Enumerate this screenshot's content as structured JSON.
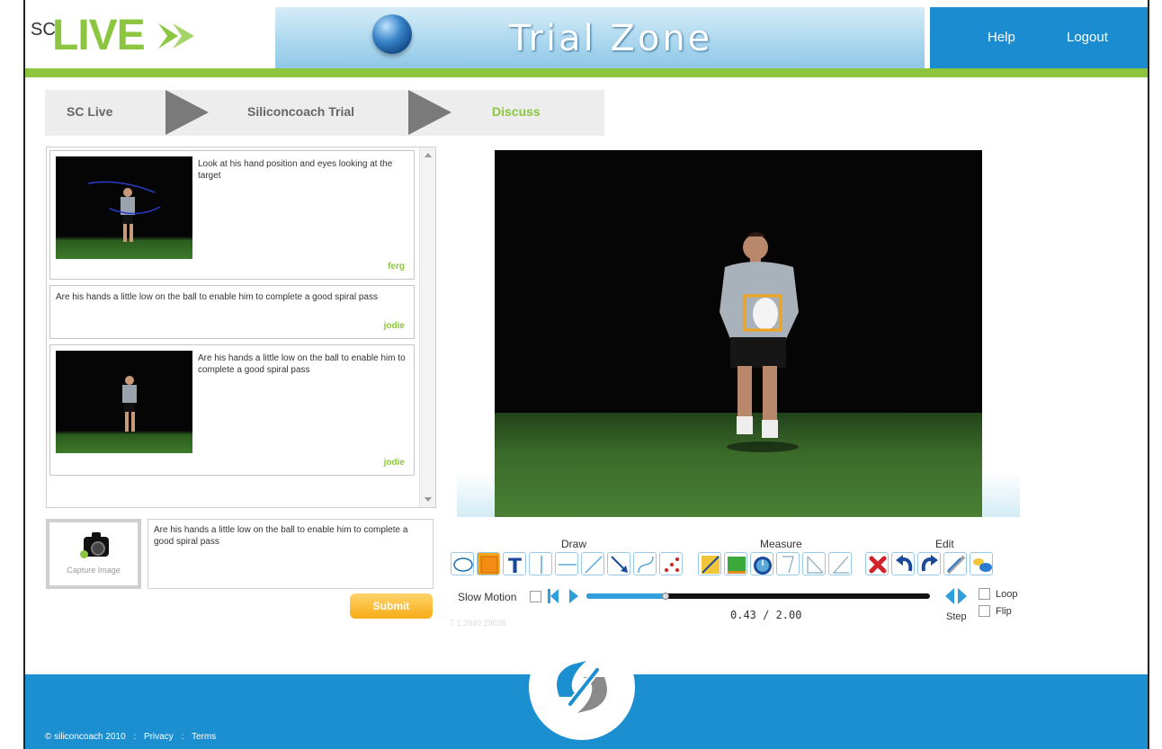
{
  "header": {
    "logo_sc": "SC",
    "logo_live": "LIVE",
    "banner_title": "Trial Zone",
    "nav": [
      "Help",
      "Logout"
    ]
  },
  "breadcrumb": [
    "SC Live",
    "Siliconcoach Trial",
    "Discuss"
  ],
  "comments": [
    {
      "text": "Look at his hand position and eyes looking at the target",
      "author": "ferg",
      "has_thumbnail": true
    },
    {
      "text": "Are his hands a little low on the ball to enable him to complete a good spiral pass",
      "author": "jodie",
      "has_thumbnail": false
    },
    {
      "text": "Are his hands a little low on the ball to enable him to complete a good spiral pass",
      "author": "jodie",
      "has_thumbnail": true
    }
  ],
  "compose": {
    "capture_label": "Capture Image",
    "message": "Are his hands a little low on the ball to enable him to complete a good spiral pass",
    "submit": "Submit"
  },
  "toolbar": {
    "draw_label": "Draw",
    "measure_label": "Measure",
    "edit_label": "Edit",
    "draw_tools": [
      "ellipse-icon",
      "rectangle-icon",
      "text-icon",
      "vertical-line-icon",
      "horizontal-line-icon",
      "line-icon",
      "arrow-icon",
      "curve-icon",
      "dots-icon"
    ],
    "measure_tools": [
      "ruler-icon",
      "area-icon",
      "stopwatch-icon",
      "angle-icon",
      "right-angle-icon",
      "angle-open-icon"
    ],
    "edit_tools": [
      "delete-icon",
      "undo-icon",
      "redo-icon",
      "pen-icon",
      "color-icon"
    ]
  },
  "playback": {
    "slow_motion_label": "Slow Motion",
    "time": "0.43 / 2.00",
    "progress": 0.215,
    "step_label": "Step",
    "loop_label": "Loop",
    "flip_label": "Flip"
  },
  "faded_text": "7.1.2940.29038",
  "footer": {
    "copyright": "© siliconcoach 2010",
    "sep": ":",
    "privacy": "Privacy",
    "terms": "Terms"
  },
  "colors": {
    "accent_green": "#8cc63f",
    "brand_blue": "#1c8fd1",
    "submit_orange": "#f6ac16"
  }
}
